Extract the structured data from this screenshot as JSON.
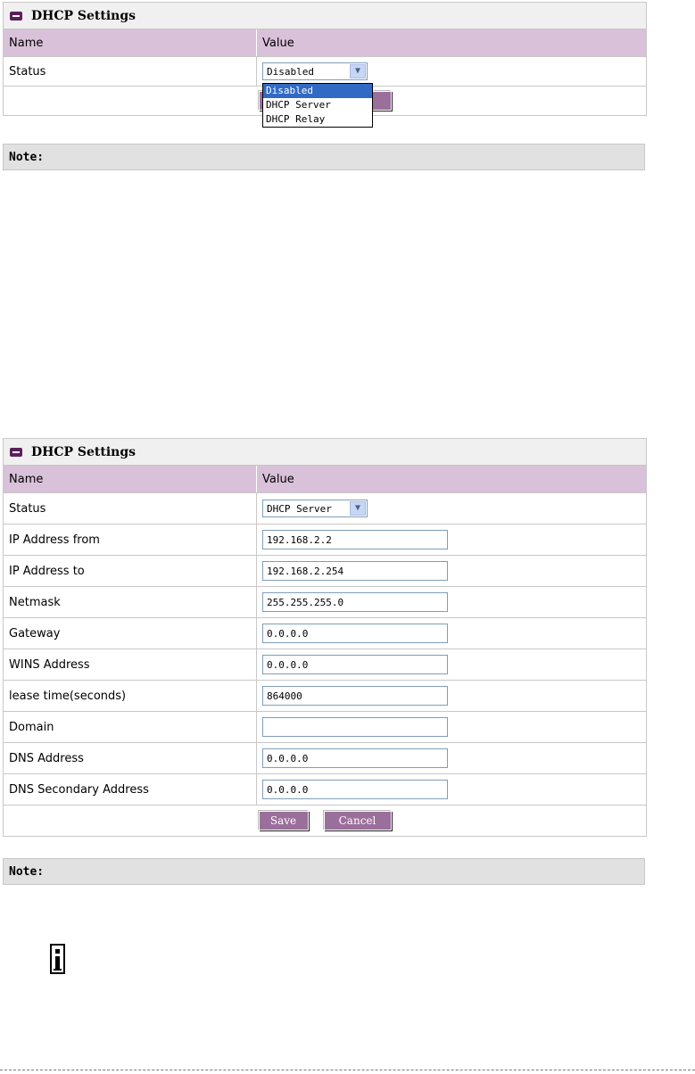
{
  "panel1": {
    "title": "DHCP Settings",
    "col_name": "Name",
    "col_value": "Value",
    "status_label": "Status",
    "status_value": "Disabled",
    "dropdown_options": [
      "Disabled",
      "DHCP Server",
      "DHCP Relay"
    ],
    "dropdown_selected": "Disabled",
    "note": "Note:"
  },
  "panel2": {
    "title": "DHCP Settings",
    "col_name": "Name",
    "col_value": "Value",
    "status_label": "Status",
    "status_value": "DHCP Server",
    "fields": [
      {
        "label": "IP Address from",
        "value": "192.168.2.2"
      },
      {
        "label": "IP Address to",
        "value": "192.168.2.254"
      },
      {
        "label": "Netmask",
        "value": "255.255.255.0"
      },
      {
        "label": "Gateway",
        "value": "0.0.0.0"
      },
      {
        "label": "WINS Address",
        "value": "0.0.0.0"
      },
      {
        "label": "lease time(seconds)",
        "value": "864000"
      },
      {
        "label": "Domain",
        "value": ""
      },
      {
        "label": "DNS Address",
        "value": "0.0.0.0"
      },
      {
        "label": "DNS Secondary Address",
        "value": "0.0.0.0"
      }
    ],
    "save_label": "Save",
    "cancel_label": "Cancel",
    "note": "Note:"
  },
  "icons": {
    "panel_header": "panel-minus-icon",
    "select_arrow": "chevron-down-icon",
    "info": "info-icon"
  },
  "colors": {
    "header_row": "#d9c1d9",
    "button": "#9b6f9b",
    "selection": "#316ac5"
  }
}
